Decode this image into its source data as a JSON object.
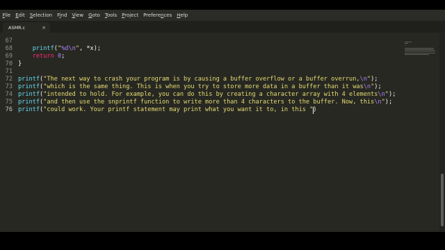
{
  "menu": {
    "items": [
      {
        "pre": "",
        "acc": "F",
        "post": "ile"
      },
      {
        "pre": "",
        "acc": "E",
        "post": "dit"
      },
      {
        "pre": "",
        "acc": "S",
        "post": "election"
      },
      {
        "pre": "F",
        "acc": "i",
        "post": "nd"
      },
      {
        "pre": "",
        "acc": "V",
        "post": "iew"
      },
      {
        "pre": "",
        "acc": "G",
        "post": "oto"
      },
      {
        "pre": "",
        "acc": "T",
        "post": "ools"
      },
      {
        "pre": "",
        "acc": "P",
        "post": "roject"
      },
      {
        "pre": "Prefere",
        "acc": "n",
        "post": "ces"
      },
      {
        "pre": "",
        "acc": "H",
        "post": "elp"
      }
    ]
  },
  "tab": {
    "title": "ASMR.c",
    "close": "×"
  },
  "colors": {
    "background": "#272822",
    "text": "#f8f8f2",
    "string": "#e6db74",
    "keyword": "#f92672",
    "number": "#ae81ff",
    "escape": "#ae81ff",
    "function": "#66d9ef",
    "line_number": "#8f908a"
  },
  "editor": {
    "current_line": 76,
    "lines": [
      {
        "num": "67",
        "tokens": []
      },
      {
        "num": "68",
        "tokens": [
          {
            "t": "    "
          },
          {
            "t": "printf",
            "c": "function"
          },
          {
            "t": "("
          },
          {
            "t": "\"",
            "c": "string"
          },
          {
            "t": "%d\\n",
            "c": "escape"
          },
          {
            "t": "\"",
            "c": "string"
          },
          {
            "t": ", *x);"
          }
        ]
      },
      {
        "num": "69",
        "tokens": [
          {
            "t": "    "
          },
          {
            "t": "return",
            "c": "keyword"
          },
          {
            "t": " "
          },
          {
            "t": "0",
            "c": "number"
          },
          {
            "t": ";"
          }
        ]
      },
      {
        "num": "70",
        "tokens": [
          {
            "t": "}"
          }
        ]
      },
      {
        "num": "71",
        "tokens": []
      },
      {
        "num": "72",
        "tokens": [
          {
            "t": "printf",
            "c": "function"
          },
          {
            "t": "("
          },
          {
            "t": "\"The next way to crash your program is by causing a buffer overflow or a buffer overrun,",
            "c": "string"
          },
          {
            "t": "\\n",
            "c": "escape"
          },
          {
            "t": "\"",
            "c": "string"
          },
          {
            "t": ");"
          }
        ]
      },
      {
        "num": "73",
        "tokens": [
          {
            "t": "printf",
            "c": "function"
          },
          {
            "t": "("
          },
          {
            "t": "\"which is the same thing. This is when you try to store more data in a buffer than it was",
            "c": "string"
          },
          {
            "t": "\\n",
            "c": "escape"
          },
          {
            "t": "\"",
            "c": "string"
          },
          {
            "t": ");"
          }
        ]
      },
      {
        "num": "74",
        "tokens": [
          {
            "t": "printf",
            "c": "function"
          },
          {
            "t": "("
          },
          {
            "t": "\"intended to hold. For example, you can do this by creating a character array with 4 elements",
            "c": "string"
          },
          {
            "t": "\\n",
            "c": "escape"
          },
          {
            "t": "\"",
            "c": "string"
          },
          {
            "t": ");"
          }
        ]
      },
      {
        "num": "75",
        "tokens": [
          {
            "t": "printf",
            "c": "function"
          },
          {
            "t": "("
          },
          {
            "t": "\"and then use the snprintf function to write more than 4 characters to the buffer. Now, this",
            "c": "string"
          },
          {
            "t": "\\n",
            "c": "escape"
          },
          {
            "t": "\"",
            "c": "string"
          },
          {
            "t": ");"
          }
        ]
      },
      {
        "num": "76",
        "tokens": [
          {
            "t": "printf",
            "c": "function"
          },
          {
            "t": "("
          },
          {
            "t": "\"could work. Your printf statement may print what you want it to, in this ",
            "c": "string"
          },
          {
            "t": "\"",
            "c": "string"
          },
          {
            "t": ")"
          }
        ]
      }
    ]
  }
}
